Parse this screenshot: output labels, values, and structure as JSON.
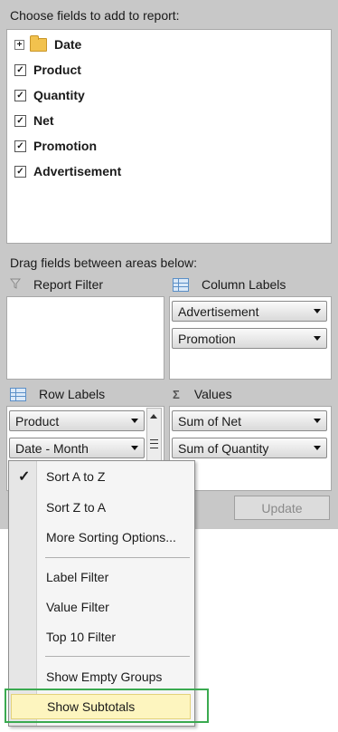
{
  "header": {
    "choose_fields": "Choose fields to add to report:",
    "drag_fields": "Drag fields between areas below:"
  },
  "fields": [
    {
      "label": "Date",
      "type": "folder",
      "expander": "+"
    },
    {
      "label": "Product",
      "checked": true
    },
    {
      "label": "Quantity",
      "checked": true
    },
    {
      "label": "Net",
      "checked": true
    },
    {
      "label": "Promotion",
      "checked": true
    },
    {
      "label": "Advertisement",
      "checked": true
    }
  ],
  "areas": {
    "report_filter": {
      "label": "Report Filter",
      "icon": "filter-icon"
    },
    "column_labels": {
      "label": "Column Labels",
      "icon": "grid-icon",
      "items": [
        "Advertisement",
        "Promotion"
      ]
    },
    "row_labels": {
      "label": "Row Labels",
      "icon": "grid-icon",
      "items": [
        "Product",
        "Date - Month"
      ]
    },
    "values": {
      "label": "Values",
      "icon": "sigma-icon",
      "symbol": "Σ",
      "items": [
        "Sum of Net",
        "Sum of Quantity"
      ]
    }
  },
  "update_button": "Update",
  "context_menu": {
    "items": [
      {
        "label": "Sort A to Z",
        "checked": true,
        "check_glyph": "✓"
      },
      {
        "label": "Sort Z to A"
      },
      {
        "label": "More Sorting Options..."
      },
      {
        "label": "Label Filter"
      },
      {
        "label": "Value Filter"
      },
      {
        "label": "Top 10 Filter"
      },
      {
        "label": "Show Empty Groups"
      },
      {
        "label": "Show Subtotals",
        "highlighted": true
      }
    ]
  },
  "colors": {
    "panel": "#c8c8c8",
    "highlight": "#fdf5bf",
    "annotation": "#3aaa50",
    "folder": "#f2c24e"
  }
}
